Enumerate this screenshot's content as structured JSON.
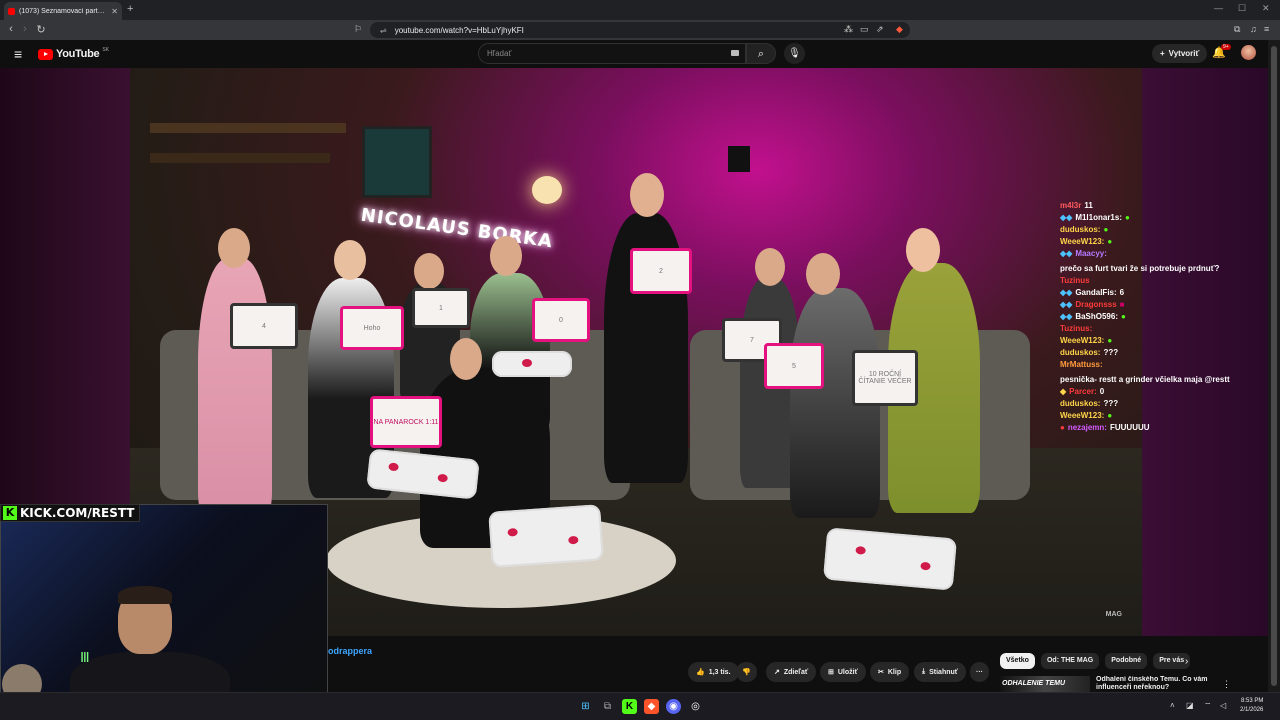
{
  "browser": {
    "tab_title": "(1073) Seznamovací party se...",
    "url": "youtube.com/watch?v=HbLuYjhyKFI"
  },
  "youtube": {
    "logo_text": "YouTube",
    "region": "SK",
    "search_placeholder": "Hľadať",
    "create_label": "Vytvoriť",
    "notification_count": "9+"
  },
  "video": {
    "neon_sign": "NICOLAUS BORKA",
    "watermark": "MAG",
    "boards": [
      "4",
      "Hoho",
      "1",
      "0",
      "2",
      "7",
      "5",
      "NA PANAROCK 1:11",
      "10 ROČNÍ ČÍTANIE VEČER"
    ]
  },
  "chat": [
    {
      "user": "m4l3r",
      "text": "11",
      "color": "#ff5b5b"
    },
    {
      "user": "M1l1onar1s:",
      "text": "",
      "color": "#ffffff"
    },
    {
      "user": "duduskos:",
      "text": "",
      "color": "#ffd54a"
    },
    {
      "user": "WeeeW123:",
      "text": "",
      "color": "#ffd54a"
    },
    {
      "user": "Maacyy:",
      "text": "prečo sa furt tvari že si potrebuje prdnuť?",
      "color": "#b47cff"
    },
    {
      "user": "Tuzinus",
      "text": "",
      "color": "#ff3b3b"
    },
    {
      "user": "GandalFis:",
      "text": "6",
      "color": "#ffffff"
    },
    {
      "user": "Dragonsss",
      "text": "",
      "color": "#ff3b3b"
    },
    {
      "user": "BaShO596:",
      "text": "",
      "color": "#ffffff"
    },
    {
      "user": "Tuzinus:",
      "text": "",
      "color": "#ff3b3b"
    },
    {
      "user": "WeeeW123:",
      "text": "",
      "color": "#ffd54a"
    },
    {
      "user": "duduskos:",
      "text": "???",
      "color": "#ffd54a"
    },
    {
      "user": "MrMattuss:",
      "text": "pesnička- restt a grinder včielka maja @restt",
      "color": "#ff9a3c"
    },
    {
      "user": "Parcer:",
      "text": "0",
      "color": "#ff3b3b"
    },
    {
      "user": "duduskos:",
      "text": "???",
      "color": "#ffd54a"
    },
    {
      "user": "WeeeW123:",
      "text": "",
      "color": "#ffd54a"
    },
    {
      "user": "nezajemn:",
      "text": "FUUUUUU",
      "color": "#d35bff"
    }
  ],
  "stream": {
    "kick_label": "KICK.COM/RESTT"
  },
  "below": {
    "channel": "odrappera",
    "likes": "1,3 tis.",
    "share": "Zdieľať",
    "save": "Uložiť",
    "clip": "Klip",
    "download": "Stiahnuť",
    "more": "···",
    "chips": [
      "Všetko",
      "Od: THE MAG",
      "Podobné",
      "Pre vás"
    ],
    "rec_thumb_text": "ODHALENIE TEMU",
    "rec_title": "Odhalení čínského Temu. Co vám influenceři neřeknou?"
  },
  "taskbar": {
    "time": "8:53 PM",
    "date": "2/1/2026"
  },
  "colors": {
    "yt_red": "#ff0000",
    "kick_green": "#53fc18",
    "board_pink": "#e3127e"
  }
}
